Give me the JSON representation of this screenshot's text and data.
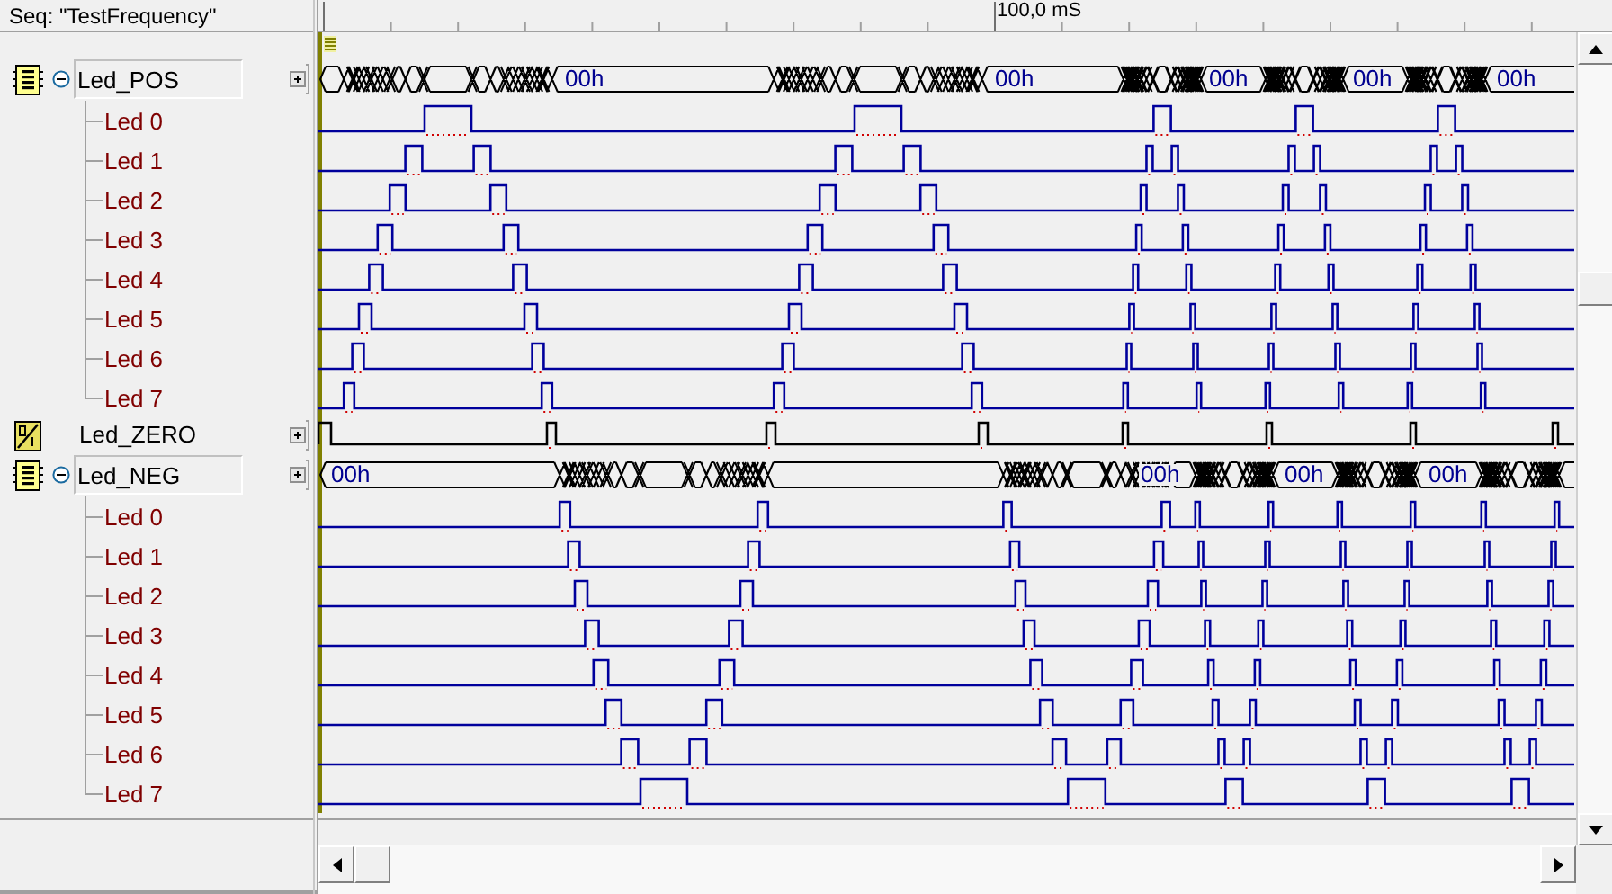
{
  "sequence_label": "Seq: \"TestFrequency\"",
  "ruler": {
    "label": "100,0 mS"
  },
  "signals": [
    {
      "name": "Led_POS",
      "kind": "bus",
      "expanded": true,
      "values": [
        "00h",
        "00h",
        "00h",
        "00h",
        "00h"
      ],
      "children": [
        {
          "name": "Led 0"
        },
        {
          "name": "Led 1"
        },
        {
          "name": "Led 2"
        },
        {
          "name": "Led 3"
        },
        {
          "name": "Led 4"
        },
        {
          "name": "Led 5"
        },
        {
          "name": "Led 6"
        },
        {
          "name": "Led 7"
        }
      ]
    },
    {
      "name": "Led_ZERO",
      "kind": "bit"
    },
    {
      "name": "Led_NEG",
      "kind": "bus",
      "expanded": true,
      "values": [
        "00h",
        "00h",
        "00h",
        "00h"
      ],
      "children": [
        {
          "name": "Led 0"
        },
        {
          "name": "Led 1"
        },
        {
          "name": "Led 2"
        },
        {
          "name": "Led 3"
        },
        {
          "name": "Led 4"
        },
        {
          "name": "Led 5"
        },
        {
          "name": "Led 6"
        },
        {
          "name": "Led 7"
        }
      ]
    }
  ]
}
